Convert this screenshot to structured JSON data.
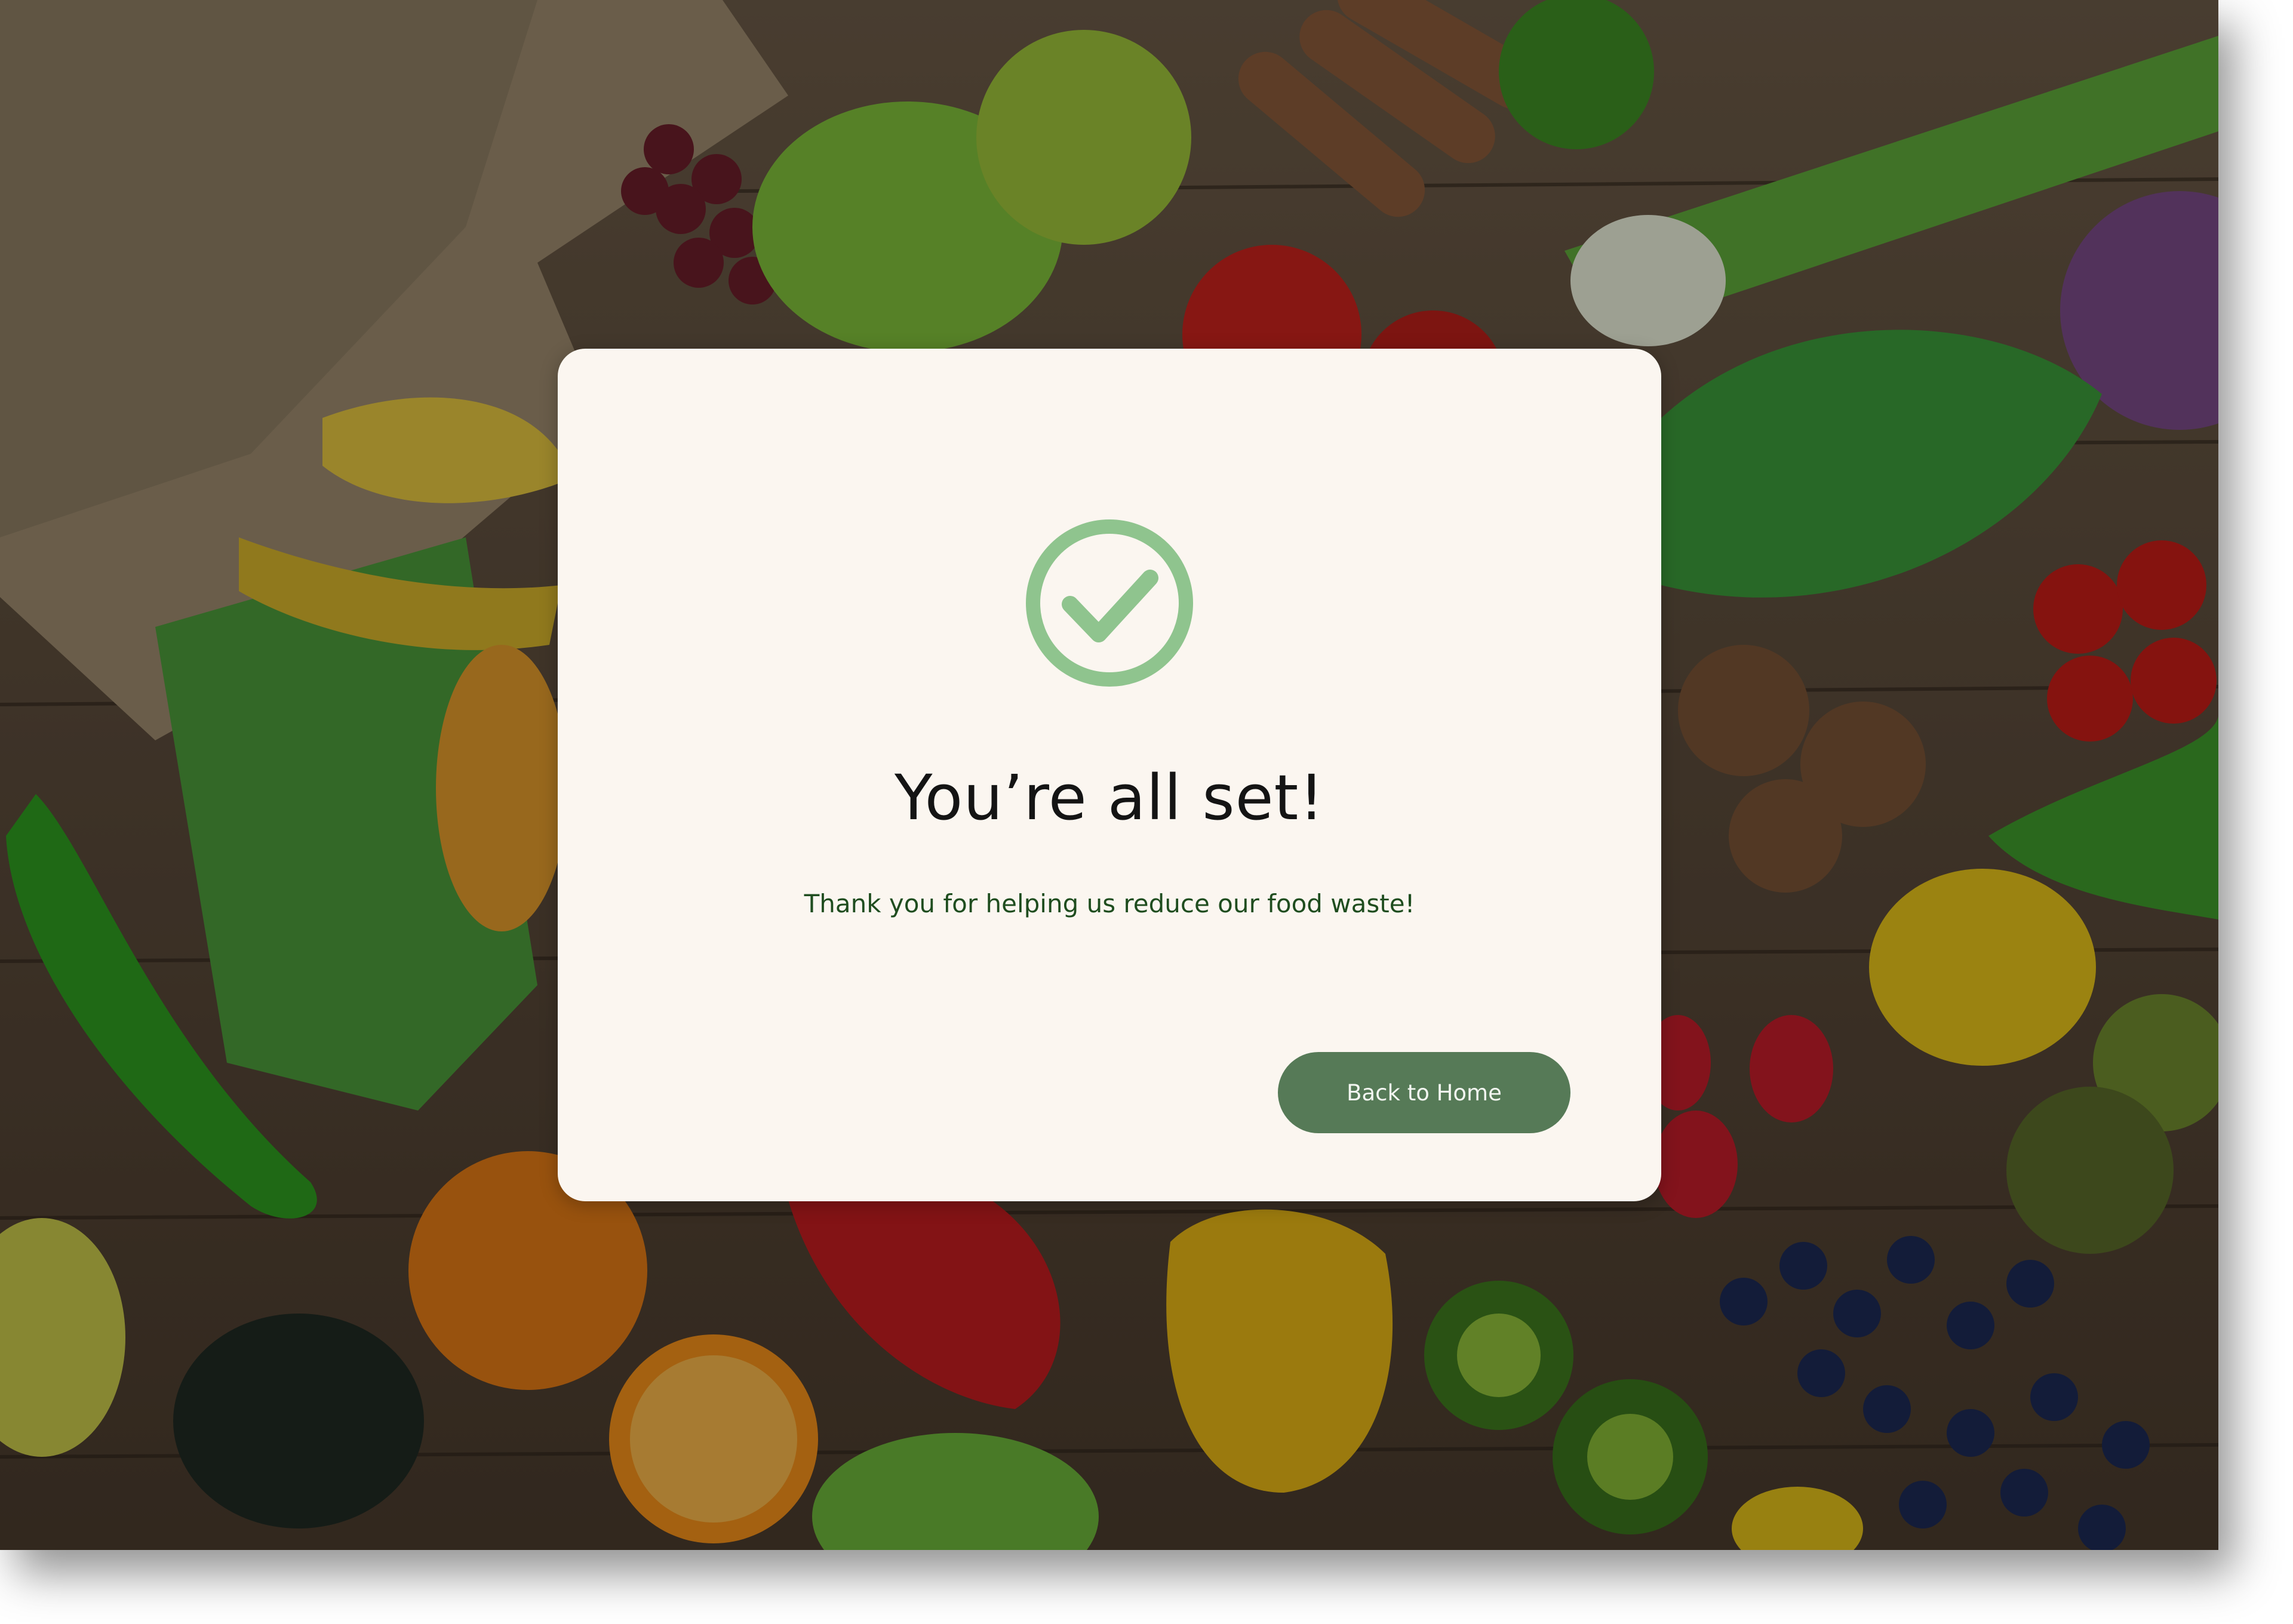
{
  "background": {
    "description_icon": "produce-photo-background"
  },
  "modal": {
    "icon": "check-circle-icon",
    "icon_color": "#8fc48e",
    "title": "You’re all set!",
    "message": "Thank you for helping us reduce our food waste!",
    "primary_button_label": "Back to Home"
  },
  "colors": {
    "modal_bg": "#fbf6f0",
    "button_bg": "#567a57",
    "message_text": "#1f4d1f",
    "title_text": "#141414"
  }
}
